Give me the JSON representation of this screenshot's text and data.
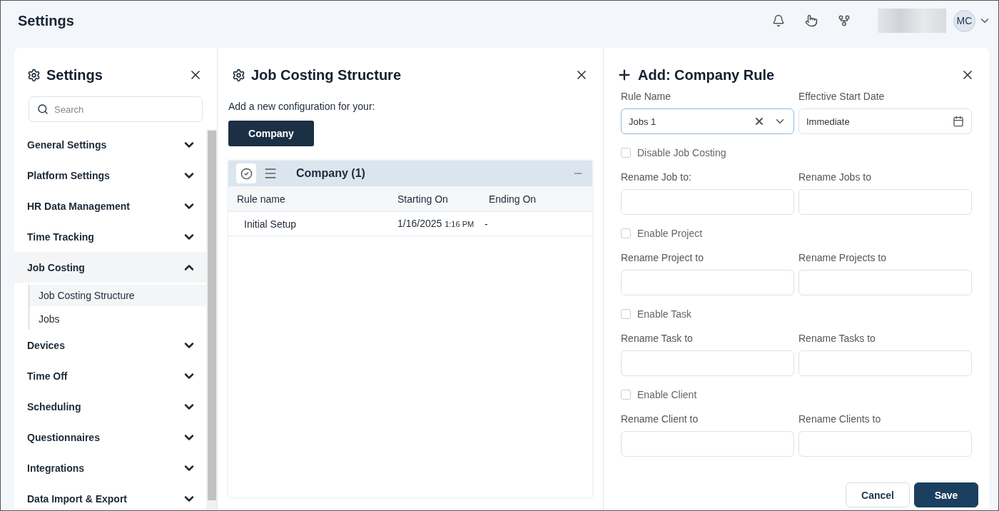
{
  "header": {
    "title": "Settings",
    "user": {
      "initials": "MC"
    }
  },
  "sidebar": {
    "title": "Settings",
    "search": {
      "placeholder": "Search"
    },
    "items": [
      {
        "label": "General Settings",
        "expanded": false
      },
      {
        "label": "Platform Settings",
        "expanded": false
      },
      {
        "label": "HR Data Management",
        "expanded": false
      },
      {
        "label": "Time Tracking",
        "expanded": false
      },
      {
        "label": "Job Costing",
        "expanded": true,
        "children": [
          {
            "label": "Job Costing Structure",
            "selected": true
          },
          {
            "label": "Jobs",
            "selected": false
          }
        ]
      },
      {
        "label": "Devices",
        "expanded": false
      },
      {
        "label": "Time Off",
        "expanded": false
      },
      {
        "label": "Scheduling",
        "expanded": false
      },
      {
        "label": "Questionnaires",
        "expanded": false
      },
      {
        "label": "Integrations",
        "expanded": false
      },
      {
        "label": "Data Import & Export",
        "expanded": false
      }
    ]
  },
  "structure": {
    "title": "Job Costing Structure",
    "prompt": "Add a new configuration for your:",
    "add_button": "Company",
    "group": {
      "title": "Company (1)",
      "columns": [
        "Rule name",
        "Starting On",
        "Ending On"
      ],
      "rows": [
        {
          "rule_name": "Initial Setup",
          "start_date": "1/16/2025",
          "start_time": "1:16 PM",
          "end": "-"
        }
      ]
    }
  },
  "rule_form": {
    "title": "Add: Company Rule",
    "rows": [
      {
        "kind": "fields",
        "fields": [
          {
            "kind": "select",
            "label": "Rule Name",
            "value": "Jobs 1",
            "focused": true
          },
          {
            "kind": "date",
            "label": "Effective Start Date",
            "value": "Immediate",
            "focused": false
          }
        ]
      },
      {
        "kind": "checkbox",
        "label": "Disable Job Costing",
        "checked": false
      },
      {
        "kind": "fields",
        "fields": [
          {
            "kind": "text",
            "label": "Rename Job to:",
            "focused": false
          },
          {
            "kind": "text",
            "label": "Rename Jobs to",
            "focused": false
          }
        ]
      },
      {
        "kind": "checkbox",
        "label": "Enable Project",
        "checked": false
      },
      {
        "kind": "fields",
        "fields": [
          {
            "kind": "text",
            "label": "Rename Project to",
            "focused": false
          },
          {
            "kind": "text",
            "label": "Rename Projects to",
            "focused": false
          }
        ]
      },
      {
        "kind": "checkbox",
        "label": "Enable Task",
        "checked": false
      },
      {
        "kind": "fields",
        "fields": [
          {
            "kind": "text",
            "label": "Rename Task to",
            "focused": false
          },
          {
            "kind": "text",
            "label": "Rename Tasks to",
            "focused": false
          }
        ]
      },
      {
        "kind": "checkbox",
        "label": "Enable Client",
        "checked": false
      },
      {
        "kind": "fields",
        "fields": [
          {
            "kind": "text",
            "label": "Rename Client to",
            "focused": false
          },
          {
            "kind": "text",
            "label": "Rename Clients to",
            "focused": false
          }
        ]
      }
    ],
    "buttons": [
      {
        "kind": "secondary",
        "label": "Cancel"
      },
      {
        "kind": "primary",
        "label": "Save"
      }
    ]
  }
}
